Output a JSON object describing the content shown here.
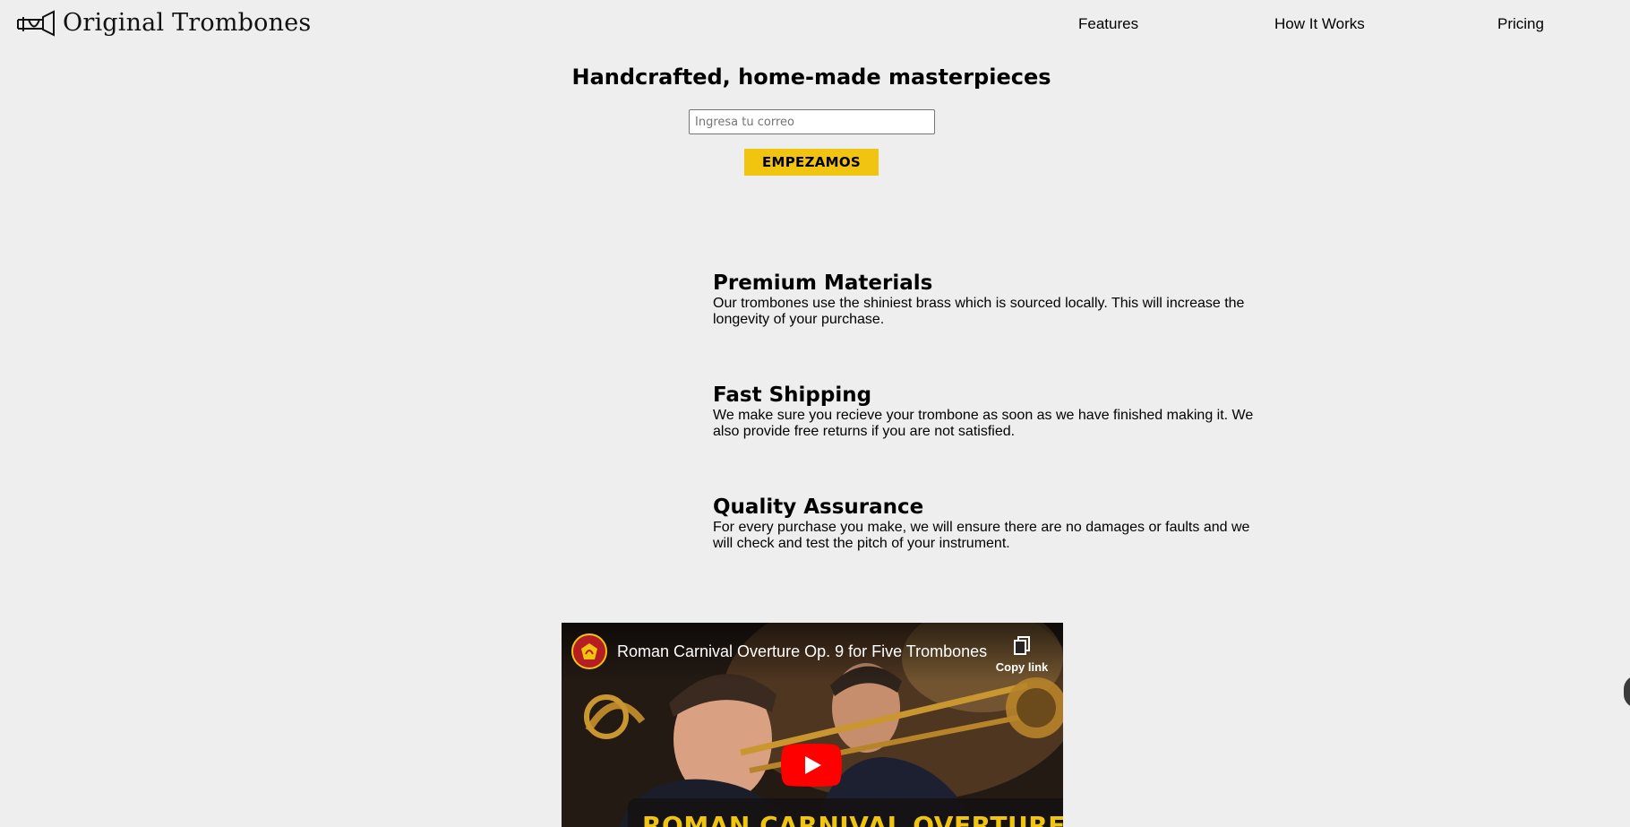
{
  "header": {
    "logo_text": "Original Trombones",
    "logo_icon": "trombone-icon",
    "nav": [
      {
        "label": "Features"
      },
      {
        "label": "How It Works"
      },
      {
        "label": "Pricing"
      }
    ]
  },
  "hero": {
    "title": "Handcrafted, home-made masterpieces",
    "email_placeholder": "Ingresa tu correo",
    "cta_label": "EMPEZAMOS"
  },
  "features": [
    {
      "title": "Premium Materials",
      "text": "Our trombones use the shiniest brass which is sourced locally. This will increase the longevity of your purchase."
    },
    {
      "title": "Fast Shipping",
      "text": "We make sure you recieve your trombone as soon as we have finished making it. We also provide free returns if you are not satisfied."
    },
    {
      "title": "Quality Assurance",
      "text": "For every purchase you make, we will ensure there are no damages or faults and we will check and test the pitch of your instrument."
    }
  ],
  "video": {
    "title": "Roman Carnival Overture Op. 9 for Five Trombones",
    "copy_link_label": "Copy link",
    "overlay_text": "ROMAN CARNIVAL OVERTURE",
    "play_icon": "youtube-play-icon",
    "copy_icon": "copy-icon"
  },
  "colors": {
    "background": "#eeeeee",
    "accent": "#f1c40f",
    "youtube_red": "#ff0000"
  }
}
